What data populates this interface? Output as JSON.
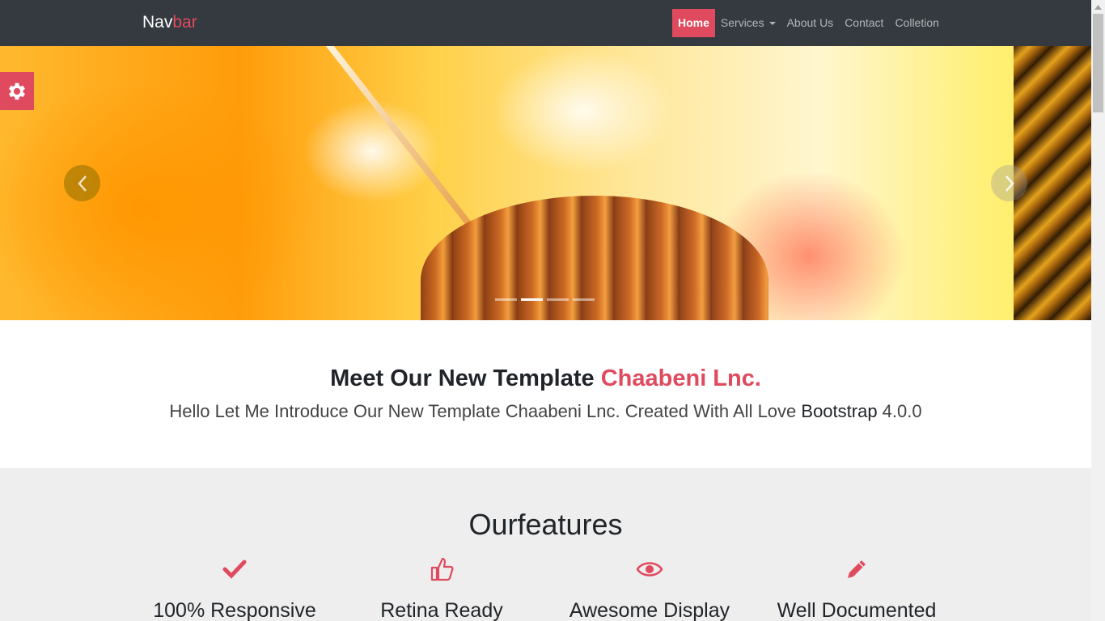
{
  "navbar": {
    "brand_part1": "Nav",
    "brand_part2": "bar",
    "links": [
      {
        "label": "Home",
        "active": true
      },
      {
        "label": "Services",
        "dropdown": true
      },
      {
        "label": "About Us"
      },
      {
        "label": "Contact"
      },
      {
        "label": "Colletion"
      }
    ]
  },
  "carousel": {
    "slide_count": 4,
    "active_index": 1,
    "prev_icon": "chevron-left-icon",
    "next_icon": "chevron-right-icon"
  },
  "settings": {
    "icon": "gear-icon"
  },
  "intro": {
    "title_main": "Meet Our New Template ",
    "title_accent": "Chaabeni Lnc.",
    "text_main": "Hello Let Me Introduce Our New Template Chaabeni Lnc. Created With All Love ",
    "text_strong": "Bootstrap",
    "text_version": " 4.0.0"
  },
  "features": {
    "title": "Ourfeatures",
    "items": [
      {
        "icon": "check-icon",
        "title": "100% Responsive"
      },
      {
        "icon": "thumbs-up-icon",
        "title": "Retina Ready"
      },
      {
        "icon": "eye-icon",
        "title": "Awesome Display"
      },
      {
        "icon": "pencil-icon",
        "title": "Well Documented"
      }
    ]
  },
  "colors": {
    "accent": "#e04a5f",
    "navbar_bg": "#343a40",
    "features_bg": "#eeeeee"
  }
}
